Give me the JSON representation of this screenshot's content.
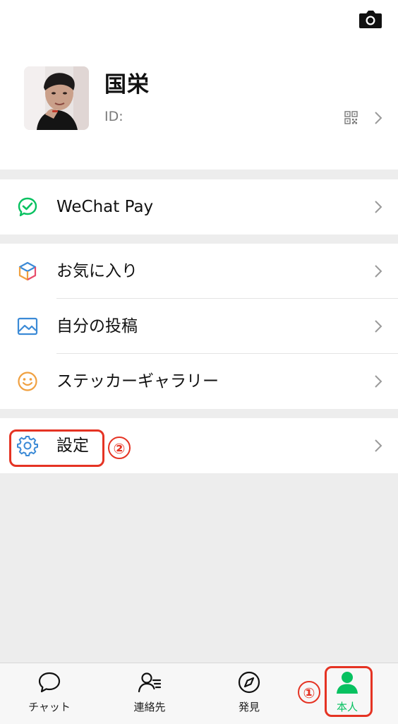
{
  "profile": {
    "name": "国栄",
    "id_label": "ID:",
    "icons": {
      "camera": "camera-icon",
      "qr": "qr-code-icon",
      "chevron": "chevron-right-icon"
    }
  },
  "menu": {
    "pay": {
      "label": "WeChat Pay",
      "icon": "wechat-pay-icon",
      "color": "#07c160"
    },
    "favorites": {
      "label": "お気に入り",
      "icon": "cube-icon"
    },
    "posts": {
      "label": "自分の投稿",
      "icon": "image-icon",
      "color": "#3b8ad6"
    },
    "stickers": {
      "label": "ステッカーギャラリー",
      "icon": "smiley-icon",
      "color": "#f0a040"
    },
    "settings": {
      "label": "設定",
      "icon": "gear-icon",
      "color": "#3b8ad6"
    }
  },
  "annotations": {
    "step1": "①",
    "step2": "②",
    "color": "#e53323"
  },
  "tabbar": {
    "active_color": "#07c160",
    "tabs": [
      {
        "label": "チャット",
        "icon": "chat-bubble-icon"
      },
      {
        "label": "連絡先",
        "icon": "contacts-icon"
      },
      {
        "label": "発見",
        "icon": "compass-icon"
      },
      {
        "label": "本人",
        "icon": "person-icon",
        "active": true
      }
    ]
  }
}
